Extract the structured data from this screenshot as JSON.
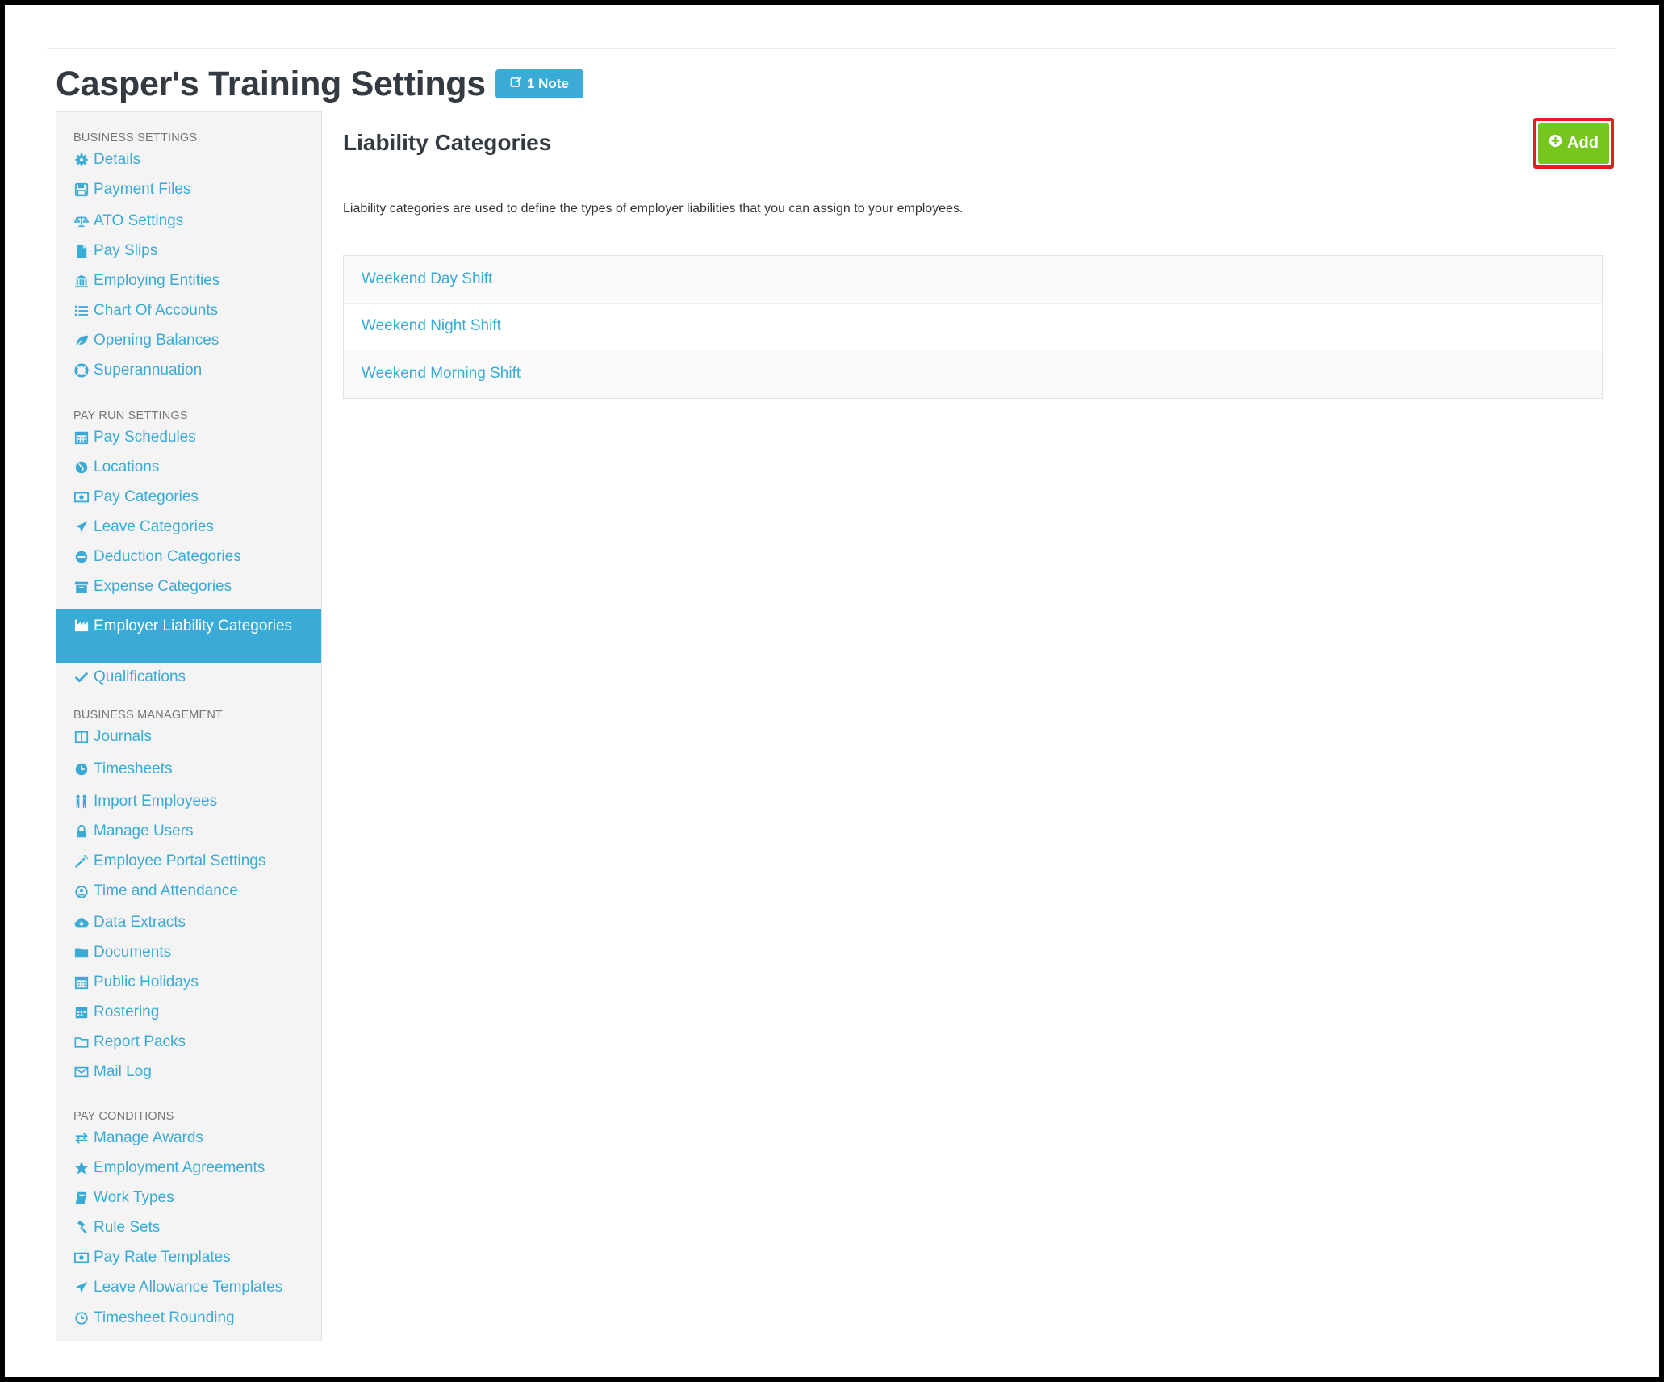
{
  "page": {
    "title": "Casper's Training Settings",
    "note_badge": "1 Note"
  },
  "sidebar": {
    "sections": [
      {
        "heading": "BUSINESS SETTINGS",
        "items": [
          {
            "label": "Details",
            "icon": "gear-icon"
          },
          {
            "label": "Payment Files",
            "icon": "floppy-icon"
          },
          {
            "label": "ATO Settings",
            "icon": "scale-icon"
          },
          {
            "label": "Pay Slips",
            "icon": "file-icon"
          },
          {
            "label": "Employing Entities",
            "icon": "bank-icon"
          },
          {
            "label": "Chart Of Accounts",
            "icon": "list-icon"
          },
          {
            "label": "Opening Balances",
            "icon": "leaf-icon"
          },
          {
            "label": "Superannuation",
            "icon": "lifebuoy-icon"
          }
        ]
      },
      {
        "heading": "PAY RUN SETTINGS",
        "items": [
          {
            "label": "Pay Schedules",
            "icon": "calendar-icon"
          },
          {
            "label": "Locations",
            "icon": "globe-icon"
          },
          {
            "label": "Pay Categories",
            "icon": "money-icon"
          },
          {
            "label": "Leave Categories",
            "icon": "plane-icon"
          },
          {
            "label": "Deduction Categories",
            "icon": "minus-circle-icon"
          },
          {
            "label": "Expense Categories",
            "icon": "archive-icon"
          },
          {
            "label": "Employer Liability Categories",
            "icon": "industry-icon",
            "active": true
          },
          {
            "label": "Qualifications",
            "icon": "check-icon"
          }
        ]
      },
      {
        "heading": "BUSINESS MANAGEMENT",
        "items": [
          {
            "label": "Journals",
            "icon": "columns-icon"
          },
          {
            "label": "Timesheets",
            "icon": "clock-icon"
          },
          {
            "label": "Import Employees",
            "icon": "users-icon"
          },
          {
            "label": "Manage Users",
            "icon": "lock-icon"
          },
          {
            "label": "Employee Portal Settings",
            "icon": "magic-wand-icon"
          },
          {
            "label": "Time and Attendance",
            "icon": "user-clock-icon"
          },
          {
            "label": "Data Extracts",
            "icon": "cloud-download-icon"
          },
          {
            "label": "Documents",
            "icon": "folder-icon"
          },
          {
            "label": "Public Holidays",
            "icon": "calendar-icon"
          },
          {
            "label": "Rostering",
            "icon": "calendar-grid-icon"
          },
          {
            "label": "Report Packs",
            "icon": "folder-open-icon"
          },
          {
            "label": "Mail Log",
            "icon": "envelope-icon"
          }
        ]
      },
      {
        "heading": "PAY CONDITIONS",
        "items": [
          {
            "label": "Manage Awards",
            "icon": "exchange-icon"
          },
          {
            "label": "Employment Agreements",
            "icon": "star-icon"
          },
          {
            "label": "Work Types",
            "icon": "book-icon"
          },
          {
            "label": "Rule Sets",
            "icon": "gavel-icon"
          },
          {
            "label": "Pay Rate Templates",
            "icon": "money-icon"
          },
          {
            "label": "Leave Allowance Templates",
            "icon": "plane-icon"
          },
          {
            "label": "Timesheet Rounding",
            "icon": "clock-outline-icon"
          }
        ]
      }
    ]
  },
  "main": {
    "title": "Liability Categories",
    "add_label": "Add",
    "description": "Liability categories are used to define the types of employer liabilities that you can assign to your employees.",
    "categories": [
      "Weekend Day Shift",
      "Weekend Night Shift",
      "Weekend Morning Shift"
    ]
  },
  "colors": {
    "accent": "#3aaad6",
    "add_button": "#77c61e",
    "highlight_outline": "#e02020",
    "title_text": "#333a41"
  }
}
